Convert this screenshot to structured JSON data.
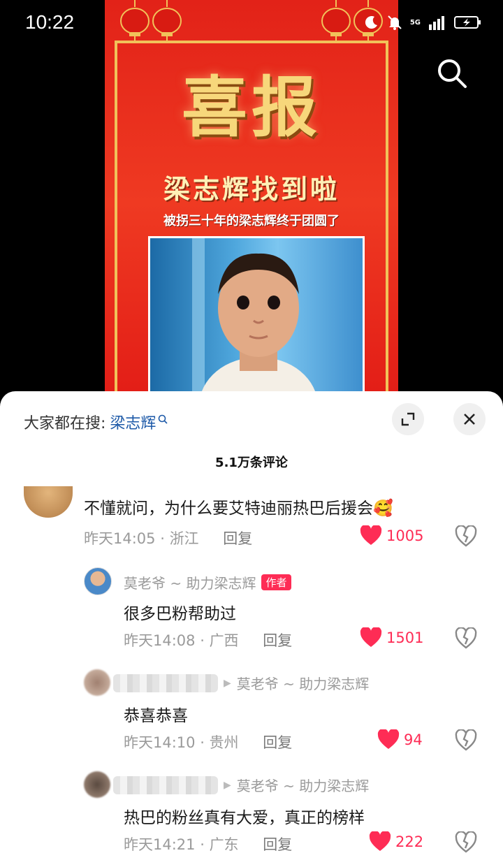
{
  "status_bar": {
    "time": "10:22",
    "icons": [
      "moon-icon",
      "bell-off-icon",
      "signal-5g-icon",
      "battery-charging-icon"
    ],
    "network": "5G"
  },
  "video": {
    "poster_title": "喜报",
    "poster_subtitle": "梁志辉找到啦",
    "poster_caption": "被拐三十年的梁志辉终于团圆了",
    "search_icon": "search-icon"
  },
  "sheet": {
    "hot_search_label": "大家都在搜:",
    "hot_search_keyword": "梁志辉",
    "comment_count": "5.1万条评论",
    "expand_icon": "expand-icon",
    "close_icon": "close-icon"
  },
  "comments": [
    {
      "text": "不懂就问，为什么要艾特迪丽热巴后援会",
      "emoji": "🥰",
      "time": "昨天14:05",
      "location": "浙江",
      "reply_label": "回复",
      "likes": "1005"
    },
    {
      "user": "莫老爷 ~ 助力梁志辉",
      "badge": "作者",
      "text": "很多巴粉帮助过",
      "time": "昨天14:08",
      "location": "广西",
      "reply_label": "回复",
      "likes": "1501"
    },
    {
      "reply_to": "莫老爷 ~ 助力梁志辉",
      "text": "恭喜恭喜",
      "time": "昨天14:10",
      "location": "贵州",
      "reply_label": "回复",
      "likes": "94"
    },
    {
      "reply_to": "莫老爷 ~ 助力梁志辉",
      "text": "热巴的粉丝真有大爱，真正的榜样",
      "time": "昨天14:21",
      "location": "广东",
      "reply_label": "回复",
      "likes": "222"
    }
  ],
  "colors": {
    "like_red": "#fe2c55",
    "link_blue": "#1e5aa8",
    "poster_red": "#e22218",
    "poster_gold": "#f1c25a"
  }
}
